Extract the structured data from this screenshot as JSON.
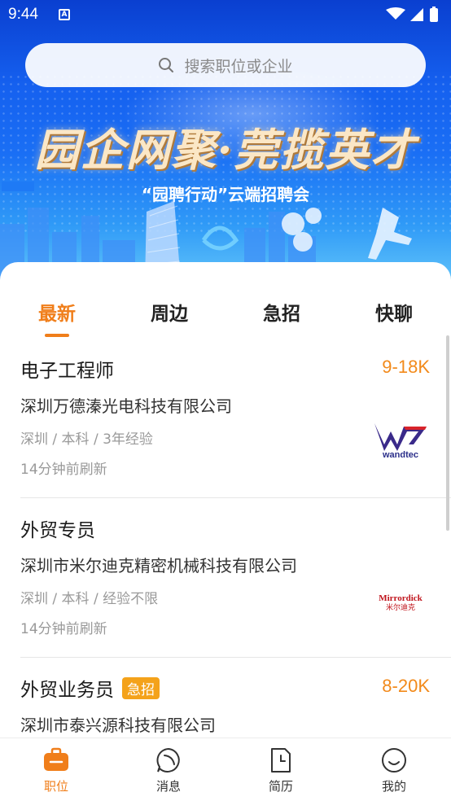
{
  "status_bar": {
    "time": "9:44"
  },
  "search": {
    "placeholder": "搜索职位或企业"
  },
  "banner": {
    "title": "园企网聚·莞揽英才",
    "subtitle": "“园聘行动”云端招聘会"
  },
  "tabs": [
    {
      "label": "最新",
      "active": true
    },
    {
      "label": "周边",
      "active": false
    },
    {
      "label": "急招",
      "active": false
    },
    {
      "label": "快聊",
      "active": false
    }
  ],
  "jobs": [
    {
      "title": "电子工程师",
      "salary": "9-18K",
      "company": "深圳万德溱光电科技有限公司",
      "meta": "深圳 / 本科 / 3年经验",
      "time": "14分钟前刷新",
      "logo_text": "wandtec"
    },
    {
      "title": "外贸专员",
      "salary": "",
      "company": "深圳市米尔迪克精密机械科技有限公司",
      "meta": "深圳 / 本科 / 经验不限",
      "time": "14分钟前刷新",
      "logo_text": "Mirrordick",
      "logo_subtext": "米尔迪克"
    },
    {
      "title": "外贸业务员",
      "badge": "急招",
      "salary": "8-20K",
      "company": "深圳市泰兴源科技有限公司",
      "meta": "",
      "time": ""
    }
  ],
  "bottom_nav": [
    {
      "label": "职位",
      "icon": "briefcase-icon",
      "active": true
    },
    {
      "label": "消息",
      "icon": "message-icon",
      "active": false
    },
    {
      "label": "简历",
      "icon": "resume-icon",
      "active": false
    },
    {
      "label": "我的",
      "icon": "profile-icon",
      "active": false
    }
  ],
  "colors": {
    "accent": "#f07e1a",
    "salary": "#f28a1b",
    "badge": "#f4a21a",
    "banner_blue": "#1560ef"
  }
}
